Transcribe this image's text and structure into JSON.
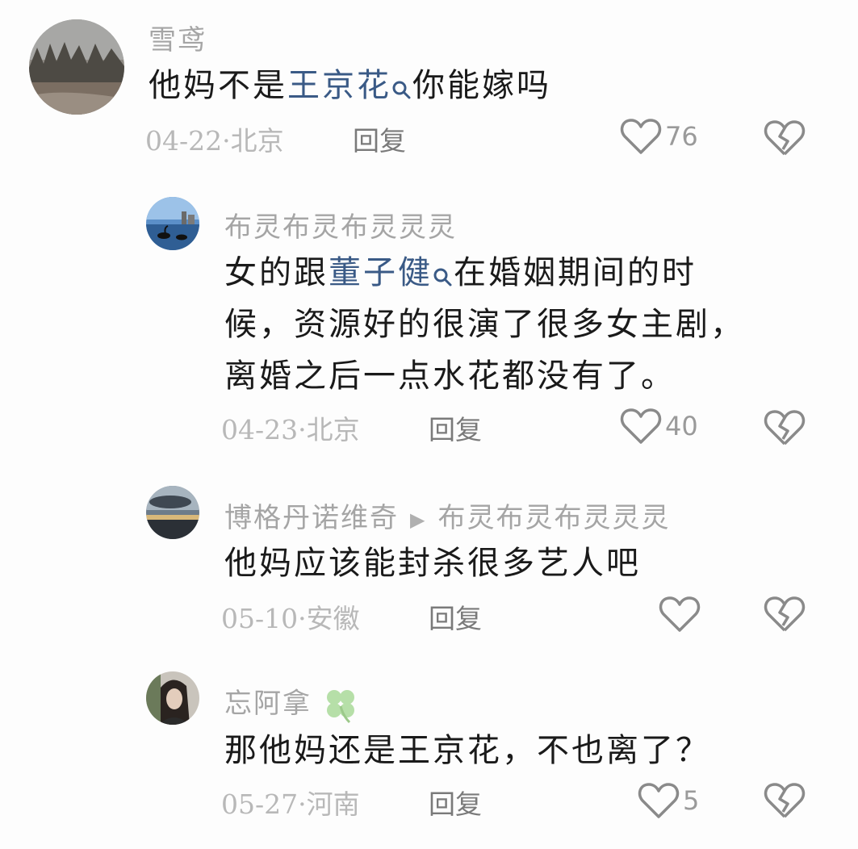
{
  "comments": [
    {
      "username": "雪鸢",
      "content": [
        {
          "text": "他妈不是"
        },
        {
          "text": "王京花",
          "link": true
        },
        {
          "text": "你能嫁吗"
        }
      ],
      "date": "04-22",
      "location": "北京",
      "reply_label": "回复",
      "likes": "76"
    },
    {
      "username": "布灵布灵布灵灵灵",
      "content_lines": [
        "候，资源好的很演了很多女主剧，",
        "离婚之后一点水花都没有了。"
      ],
      "content_first": [
        {
          "text": "女的跟"
        },
        {
          "text": "董子健",
          "link": true
        },
        {
          "text": "在婚姻期间的时"
        }
      ],
      "date": "04-23",
      "location": "北京",
      "reply_label": "回复",
      "likes": "40"
    },
    {
      "username": "博格丹诺维奇",
      "reply_to": "布灵布灵布灵灵灵",
      "content": "他妈应该能封杀很多艺人吧",
      "date": "05-10",
      "location": "安徽",
      "reply_label": "回复",
      "likes": ""
    },
    {
      "username": "忘阿拿",
      "badge": "🍀",
      "content": "那他妈还是王京花，不也离了？",
      "date": "05-27",
      "location": "河南",
      "reply_label": "回复",
      "likes": "5"
    }
  ],
  "colors": {
    "link": "#3a5a86",
    "username": "#a5a5a5",
    "meta": "#b8b8b8",
    "icon": "#8a8a8a"
  },
  "icons": {
    "like": "heart-outline-icon",
    "dislike": "broken-heart-icon",
    "search": "search-icon",
    "reply_arrow": "triangle-right-icon",
    "badge": "four-leaf-clover-icon"
  }
}
